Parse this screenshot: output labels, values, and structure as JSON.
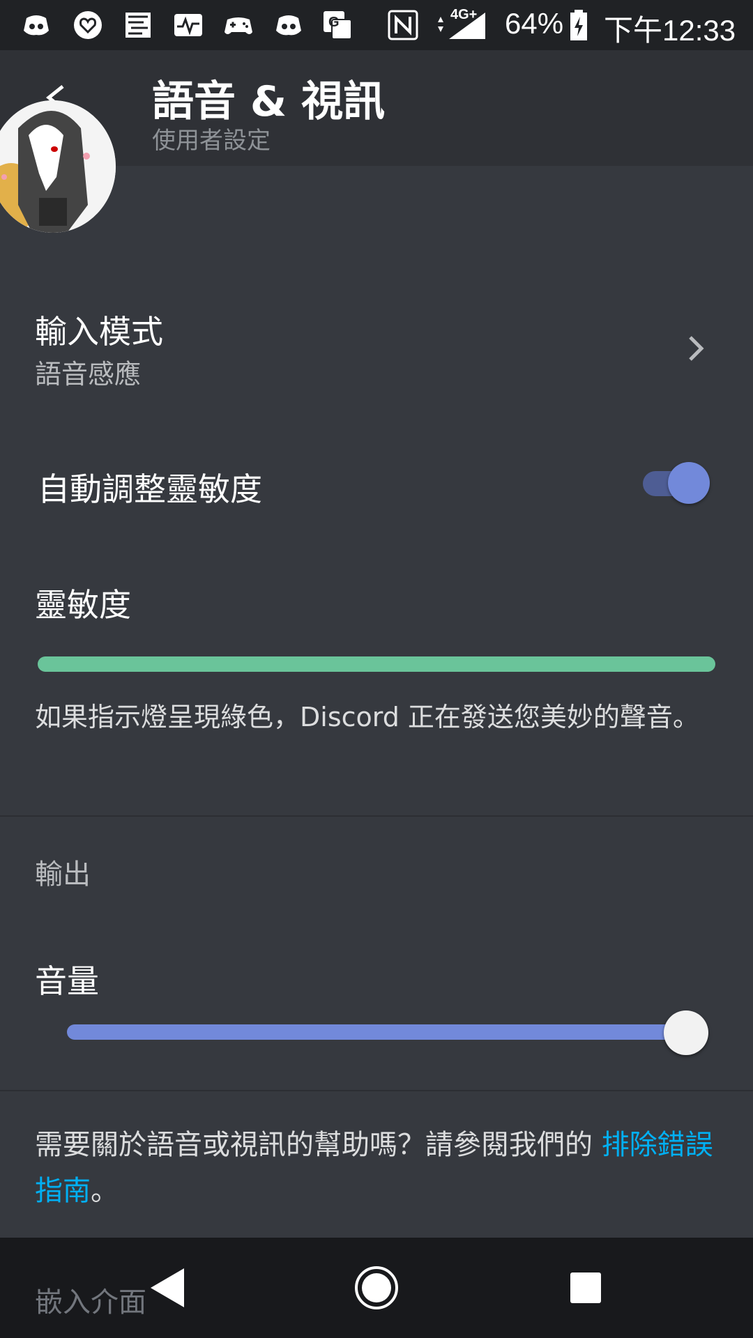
{
  "status_bar": {
    "battery": "64%",
    "network": "4G+",
    "time": "下午12:33",
    "icons": [
      "discord-icon",
      "heart-app-icon",
      "map-icon",
      "activity-icon",
      "gamepad-icon",
      "discord-icon",
      "translate-icon",
      "nfc-icon",
      "signal-icon",
      "battery-icon"
    ]
  },
  "header": {
    "title": "語音 & 視訊",
    "subtitle": "使用者設定"
  },
  "input_mode": {
    "label": "輸入模式",
    "value": "語音感應"
  },
  "auto_sensitivity": {
    "label": "自動調整靈敏度",
    "enabled": true
  },
  "sensitivity": {
    "label": "靈敏度",
    "indicator_color": "#6ac49a",
    "description": "如果指示燈呈現綠色，Discord 正在發送您美妙的聲音。"
  },
  "output": {
    "section_label": "輸出",
    "volume_label": "音量",
    "volume_level": 1.0
  },
  "help": {
    "text": "需要關於語音或視訊的幫助嗎？請參閱我們的 ",
    "link": "排除錯誤指南",
    "suffix": "。"
  },
  "next_section": {
    "label": "嵌入介面"
  },
  "colors": {
    "accent": "#7289da",
    "link": "#00b0f4",
    "background": "#36393f",
    "header": "#2f3136"
  }
}
